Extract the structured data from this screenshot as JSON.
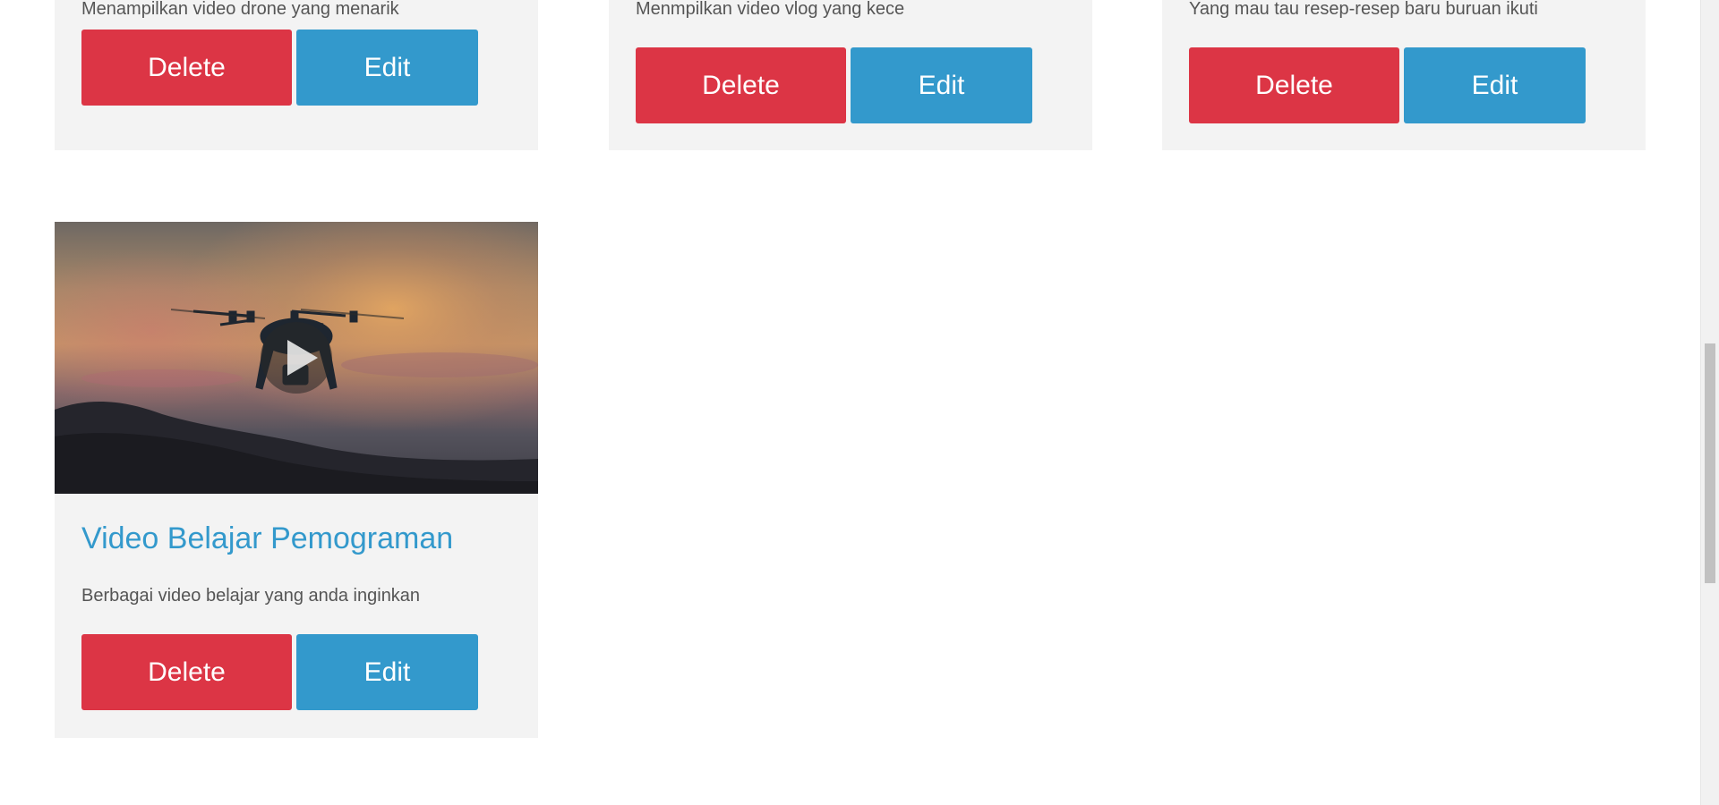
{
  "cards": [
    {
      "description": "Menampilkan video drone yang menarik",
      "delete_label": "Delete",
      "edit_label": "Edit"
    },
    {
      "description": "Menmpilkan video vlog yang kece",
      "delete_label": "Delete",
      "edit_label": "Edit"
    },
    {
      "description": "Yang mau tau resep-resep baru buruan ikuti",
      "delete_label": "Delete",
      "edit_label": "Edit"
    },
    {
      "title": "Video Belajar Pemograman",
      "description": "Berbagai video belajar yang anda inginkan",
      "delete_label": "Delete",
      "edit_label": "Edit",
      "thumbnail_icon": "play-icon"
    }
  ],
  "colors": {
    "delete": "#dc3545",
    "edit": "#3399cc",
    "card_bg": "#f3f3f3",
    "title": "#3399cc"
  }
}
